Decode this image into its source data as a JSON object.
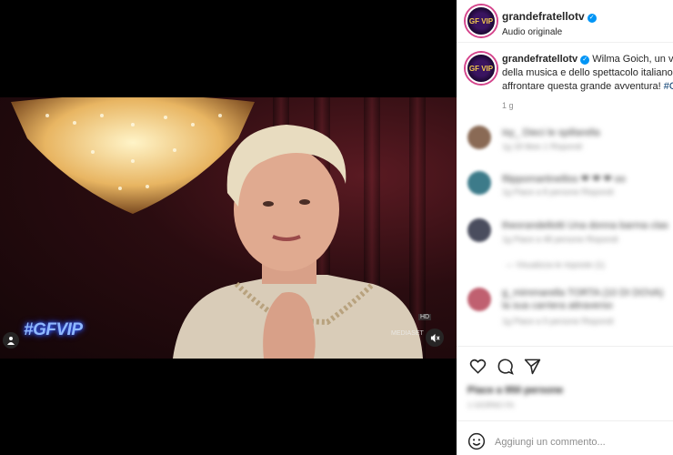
{
  "post": {
    "username": "grandefratellotv",
    "audio": "Audio originale",
    "avatar_text": "GF VIP",
    "video_watermark": "#GFVIP",
    "hd_badge": "HD",
    "broadcaster": "MEDIASET",
    "caption_line1": "Wilma Goich, un vol",
    "caption_line2": "della musica e dello spettacolo italiano: l",
    "caption_line3_text": "affrontare questa grande avventura! ",
    "caption_line3_tag": "#G",
    "timestamp": "1 g"
  },
  "comments": [
    {
      "line1": "isy_  Dieci le spillarella",
      "line2": "1g   18 likes 1   Rispondi",
      "avatar_color": "#8a6a55"
    },
    {
      "line1": "filippomartinelliss  ❤ ❤ ❤ oo",
      "line2": "1g   Piace a 8 persone   Rispondi",
      "avatar_color": "#3d7b8a"
    },
    {
      "line1": "theorandellotti  Una donna barma clas",
      "line2": "1g   Piace a 48 persone   Rispondi",
      "avatar_color": "#4a4d5e"
    },
    {
      "line1": "—   Visualizza le risposte (1)",
      "line2": "",
      "avatar_color": ""
    },
    {
      "line1": "g_mimmarella  TORTA (10 DI DOVA)",
      "line2": "1g   Piace a 9 persone   Rispondi",
      "avatar_color": "#c06070",
      "line0": "la sua carriera attraverso"
    }
  ],
  "likes": {
    "text": "Piace a 950 persone",
    "time": "1 GIORNO FA"
  },
  "add_comment": {
    "placeholder": "Aggiungi un commento..."
  },
  "colors": {
    "verified": "#0095f6",
    "hashtag": "#00376b",
    "avatar_ring": "#d4438b"
  }
}
